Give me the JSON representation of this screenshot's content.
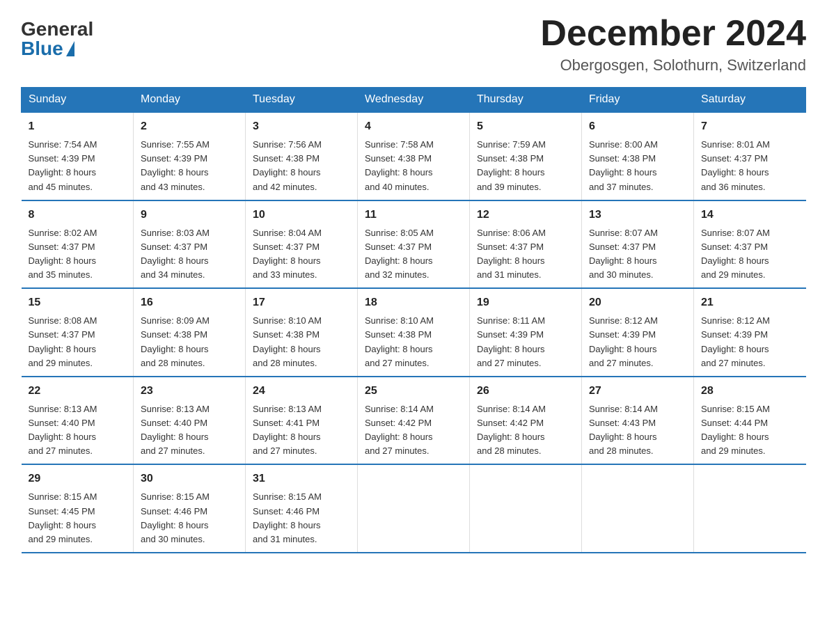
{
  "header": {
    "logo_general": "General",
    "logo_blue": "Blue",
    "month_title": "December 2024",
    "location": "Obergosgen, Solothurn, Switzerland"
  },
  "days_of_week": [
    "Sunday",
    "Monday",
    "Tuesday",
    "Wednesday",
    "Thursday",
    "Friday",
    "Saturday"
  ],
  "weeks": [
    [
      {
        "day": "1",
        "sunrise": "7:54 AM",
        "sunset": "4:39 PM",
        "daylight": "8 hours and 45 minutes."
      },
      {
        "day": "2",
        "sunrise": "7:55 AM",
        "sunset": "4:39 PM",
        "daylight": "8 hours and 43 minutes."
      },
      {
        "day": "3",
        "sunrise": "7:56 AM",
        "sunset": "4:38 PM",
        "daylight": "8 hours and 42 minutes."
      },
      {
        "day": "4",
        "sunrise": "7:58 AM",
        "sunset": "4:38 PM",
        "daylight": "8 hours and 40 minutes."
      },
      {
        "day": "5",
        "sunrise": "7:59 AM",
        "sunset": "4:38 PM",
        "daylight": "8 hours and 39 minutes."
      },
      {
        "day": "6",
        "sunrise": "8:00 AM",
        "sunset": "4:38 PM",
        "daylight": "8 hours and 37 minutes."
      },
      {
        "day": "7",
        "sunrise": "8:01 AM",
        "sunset": "4:37 PM",
        "daylight": "8 hours and 36 minutes."
      }
    ],
    [
      {
        "day": "8",
        "sunrise": "8:02 AM",
        "sunset": "4:37 PM",
        "daylight": "8 hours and 35 minutes."
      },
      {
        "day": "9",
        "sunrise": "8:03 AM",
        "sunset": "4:37 PM",
        "daylight": "8 hours and 34 minutes."
      },
      {
        "day": "10",
        "sunrise": "8:04 AM",
        "sunset": "4:37 PM",
        "daylight": "8 hours and 33 minutes."
      },
      {
        "day": "11",
        "sunrise": "8:05 AM",
        "sunset": "4:37 PM",
        "daylight": "8 hours and 32 minutes."
      },
      {
        "day": "12",
        "sunrise": "8:06 AM",
        "sunset": "4:37 PM",
        "daylight": "8 hours and 31 minutes."
      },
      {
        "day": "13",
        "sunrise": "8:07 AM",
        "sunset": "4:37 PM",
        "daylight": "8 hours and 30 minutes."
      },
      {
        "day": "14",
        "sunrise": "8:07 AM",
        "sunset": "4:37 PM",
        "daylight": "8 hours and 29 minutes."
      }
    ],
    [
      {
        "day": "15",
        "sunrise": "8:08 AM",
        "sunset": "4:37 PM",
        "daylight": "8 hours and 29 minutes."
      },
      {
        "day": "16",
        "sunrise": "8:09 AM",
        "sunset": "4:38 PM",
        "daylight": "8 hours and 28 minutes."
      },
      {
        "day": "17",
        "sunrise": "8:10 AM",
        "sunset": "4:38 PM",
        "daylight": "8 hours and 28 minutes."
      },
      {
        "day": "18",
        "sunrise": "8:10 AM",
        "sunset": "4:38 PM",
        "daylight": "8 hours and 27 minutes."
      },
      {
        "day": "19",
        "sunrise": "8:11 AM",
        "sunset": "4:39 PM",
        "daylight": "8 hours and 27 minutes."
      },
      {
        "day": "20",
        "sunrise": "8:12 AM",
        "sunset": "4:39 PM",
        "daylight": "8 hours and 27 minutes."
      },
      {
        "day": "21",
        "sunrise": "8:12 AM",
        "sunset": "4:39 PM",
        "daylight": "8 hours and 27 minutes."
      }
    ],
    [
      {
        "day": "22",
        "sunrise": "8:13 AM",
        "sunset": "4:40 PM",
        "daylight": "8 hours and 27 minutes."
      },
      {
        "day": "23",
        "sunrise": "8:13 AM",
        "sunset": "4:40 PM",
        "daylight": "8 hours and 27 minutes."
      },
      {
        "day": "24",
        "sunrise": "8:13 AM",
        "sunset": "4:41 PM",
        "daylight": "8 hours and 27 minutes."
      },
      {
        "day": "25",
        "sunrise": "8:14 AM",
        "sunset": "4:42 PM",
        "daylight": "8 hours and 27 minutes."
      },
      {
        "day": "26",
        "sunrise": "8:14 AM",
        "sunset": "4:42 PM",
        "daylight": "8 hours and 28 minutes."
      },
      {
        "day": "27",
        "sunrise": "8:14 AM",
        "sunset": "4:43 PM",
        "daylight": "8 hours and 28 minutes."
      },
      {
        "day": "28",
        "sunrise": "8:15 AM",
        "sunset": "4:44 PM",
        "daylight": "8 hours and 29 minutes."
      }
    ],
    [
      {
        "day": "29",
        "sunrise": "8:15 AM",
        "sunset": "4:45 PM",
        "daylight": "8 hours and 29 minutes."
      },
      {
        "day": "30",
        "sunrise": "8:15 AM",
        "sunset": "4:46 PM",
        "daylight": "8 hours and 30 minutes."
      },
      {
        "day": "31",
        "sunrise": "8:15 AM",
        "sunset": "4:46 PM",
        "daylight": "8 hours and 31 minutes."
      },
      {
        "day": "",
        "sunrise": "",
        "sunset": "",
        "daylight": ""
      },
      {
        "day": "",
        "sunrise": "",
        "sunset": "",
        "daylight": ""
      },
      {
        "day": "",
        "sunrise": "",
        "sunset": "",
        "daylight": ""
      },
      {
        "day": "",
        "sunrise": "",
        "sunset": "",
        "daylight": ""
      }
    ]
  ],
  "labels": {
    "sunrise_prefix": "Sunrise: ",
    "sunset_prefix": "Sunset: ",
    "daylight_prefix": "Daylight: "
  }
}
